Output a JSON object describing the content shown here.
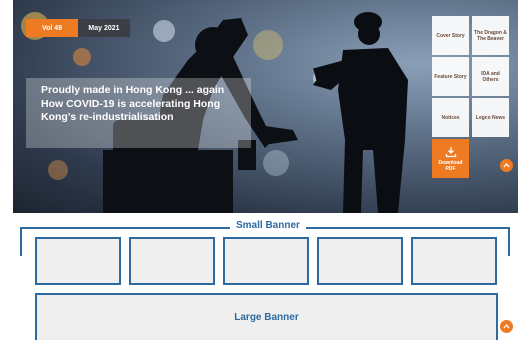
{
  "hero": {
    "volume": "Vol 49",
    "date": "May 2021",
    "headline": "Proudly made in Hong Kong ... again How COVID-19 is accelerating Hong Kong's re-industrialisation"
  },
  "tiles": [
    {
      "label": "Cover Story"
    },
    {
      "label": "The Dragon & The Beaver"
    },
    {
      "label": "Feature Story"
    },
    {
      "label": "IDA and Others"
    },
    {
      "label": "Notices"
    },
    {
      "label": "Legco News"
    },
    {
      "label": "Download PDF",
      "icon": "download-icon"
    }
  ],
  "banners": {
    "small_title": "Small Banner",
    "large_title": "Large Banner"
  },
  "colors": {
    "accent_orange": "#ee7b22",
    "banner_blue": "#2c6aa0"
  }
}
